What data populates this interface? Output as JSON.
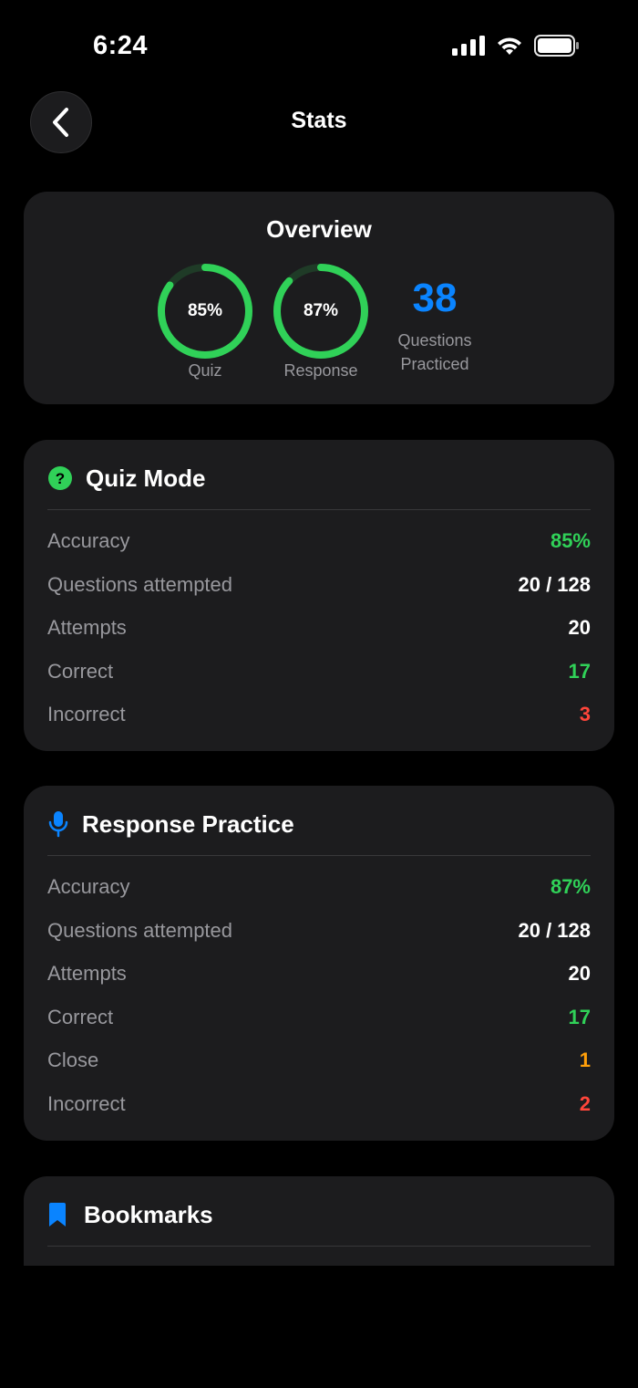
{
  "status": {
    "time": "6:24"
  },
  "nav": {
    "title": "Stats"
  },
  "overview": {
    "title": "Overview",
    "quiz": {
      "percent_label": "85%",
      "label": "Quiz",
      "value": 0.85
    },
    "response": {
      "percent_label": "87%",
      "label": "Response",
      "value": 0.87
    },
    "count": "38",
    "count_label_1": "Questions",
    "count_label_2": "Practiced"
  },
  "quiz_mode": {
    "title": "Quiz Mode",
    "rows": [
      {
        "label": "Accuracy",
        "value": "85%"
      },
      {
        "label": "Questions attempted",
        "value": "20 / 128"
      },
      {
        "label": "Attempts",
        "value": "20"
      },
      {
        "label": "Correct",
        "value": "17"
      },
      {
        "label": "Incorrect",
        "value": "3"
      }
    ]
  },
  "response_practice": {
    "title": "Response Practice",
    "rows": [
      {
        "label": "Accuracy",
        "value": "87%"
      },
      {
        "label": "Questions attempted",
        "value": "20 / 128"
      },
      {
        "label": "Attempts",
        "value": "20"
      },
      {
        "label": "Correct",
        "value": "17"
      },
      {
        "label": "Close",
        "value": "1"
      },
      {
        "label": "Incorrect",
        "value": "2"
      }
    ]
  },
  "bookmarks": {
    "title": "Bookmarks"
  },
  "colors": {
    "accent_green": "#30d158",
    "accent_blue": "#0a84ff",
    "accent_red": "#ff453a",
    "accent_orange": "#ff9f0a",
    "card_bg": "#1c1c1e"
  }
}
